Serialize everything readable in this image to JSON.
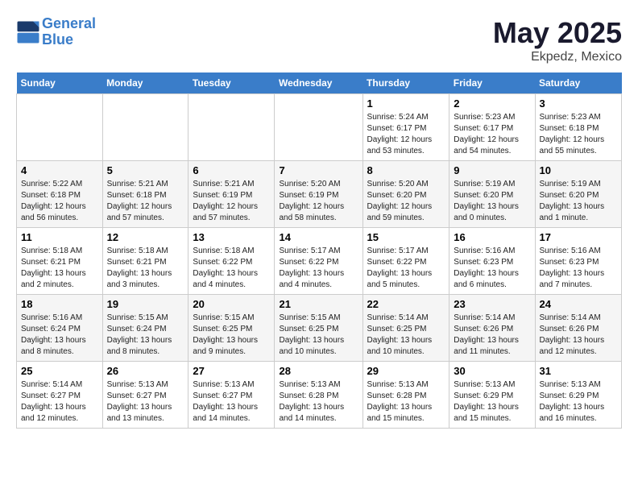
{
  "header": {
    "logo_line1": "General",
    "logo_line2": "Blue",
    "month_title": "May 2025",
    "location": "Ekpedz, Mexico"
  },
  "days_of_week": [
    "Sunday",
    "Monday",
    "Tuesday",
    "Wednesday",
    "Thursday",
    "Friday",
    "Saturday"
  ],
  "weeks": [
    [
      {
        "day": "",
        "info": ""
      },
      {
        "day": "",
        "info": ""
      },
      {
        "day": "",
        "info": ""
      },
      {
        "day": "",
        "info": ""
      },
      {
        "day": "1",
        "info": "Sunrise: 5:24 AM\nSunset: 6:17 PM\nDaylight: 12 hours\nand 53 minutes."
      },
      {
        "day": "2",
        "info": "Sunrise: 5:23 AM\nSunset: 6:17 PM\nDaylight: 12 hours\nand 54 minutes."
      },
      {
        "day": "3",
        "info": "Sunrise: 5:23 AM\nSunset: 6:18 PM\nDaylight: 12 hours\nand 55 minutes."
      }
    ],
    [
      {
        "day": "4",
        "info": "Sunrise: 5:22 AM\nSunset: 6:18 PM\nDaylight: 12 hours\nand 56 minutes."
      },
      {
        "day": "5",
        "info": "Sunrise: 5:21 AM\nSunset: 6:18 PM\nDaylight: 12 hours\nand 57 minutes."
      },
      {
        "day": "6",
        "info": "Sunrise: 5:21 AM\nSunset: 6:19 PM\nDaylight: 12 hours\nand 57 minutes."
      },
      {
        "day": "7",
        "info": "Sunrise: 5:20 AM\nSunset: 6:19 PM\nDaylight: 12 hours\nand 58 minutes."
      },
      {
        "day": "8",
        "info": "Sunrise: 5:20 AM\nSunset: 6:20 PM\nDaylight: 12 hours\nand 59 minutes."
      },
      {
        "day": "9",
        "info": "Sunrise: 5:19 AM\nSunset: 6:20 PM\nDaylight: 13 hours\nand 0 minutes."
      },
      {
        "day": "10",
        "info": "Sunrise: 5:19 AM\nSunset: 6:20 PM\nDaylight: 13 hours\nand 1 minute."
      }
    ],
    [
      {
        "day": "11",
        "info": "Sunrise: 5:18 AM\nSunset: 6:21 PM\nDaylight: 13 hours\nand 2 minutes."
      },
      {
        "day": "12",
        "info": "Sunrise: 5:18 AM\nSunset: 6:21 PM\nDaylight: 13 hours\nand 3 minutes."
      },
      {
        "day": "13",
        "info": "Sunrise: 5:18 AM\nSunset: 6:22 PM\nDaylight: 13 hours\nand 4 minutes."
      },
      {
        "day": "14",
        "info": "Sunrise: 5:17 AM\nSunset: 6:22 PM\nDaylight: 13 hours\nand 4 minutes."
      },
      {
        "day": "15",
        "info": "Sunrise: 5:17 AM\nSunset: 6:22 PM\nDaylight: 13 hours\nand 5 minutes."
      },
      {
        "day": "16",
        "info": "Sunrise: 5:16 AM\nSunset: 6:23 PM\nDaylight: 13 hours\nand 6 minutes."
      },
      {
        "day": "17",
        "info": "Sunrise: 5:16 AM\nSunset: 6:23 PM\nDaylight: 13 hours\nand 7 minutes."
      }
    ],
    [
      {
        "day": "18",
        "info": "Sunrise: 5:16 AM\nSunset: 6:24 PM\nDaylight: 13 hours\nand 8 minutes."
      },
      {
        "day": "19",
        "info": "Sunrise: 5:15 AM\nSunset: 6:24 PM\nDaylight: 13 hours\nand 8 minutes."
      },
      {
        "day": "20",
        "info": "Sunrise: 5:15 AM\nSunset: 6:25 PM\nDaylight: 13 hours\nand 9 minutes."
      },
      {
        "day": "21",
        "info": "Sunrise: 5:15 AM\nSunset: 6:25 PM\nDaylight: 13 hours\nand 10 minutes."
      },
      {
        "day": "22",
        "info": "Sunrise: 5:14 AM\nSunset: 6:25 PM\nDaylight: 13 hours\nand 10 minutes."
      },
      {
        "day": "23",
        "info": "Sunrise: 5:14 AM\nSunset: 6:26 PM\nDaylight: 13 hours\nand 11 minutes."
      },
      {
        "day": "24",
        "info": "Sunrise: 5:14 AM\nSunset: 6:26 PM\nDaylight: 13 hours\nand 12 minutes."
      }
    ],
    [
      {
        "day": "25",
        "info": "Sunrise: 5:14 AM\nSunset: 6:27 PM\nDaylight: 13 hours\nand 12 minutes."
      },
      {
        "day": "26",
        "info": "Sunrise: 5:13 AM\nSunset: 6:27 PM\nDaylight: 13 hours\nand 13 minutes."
      },
      {
        "day": "27",
        "info": "Sunrise: 5:13 AM\nSunset: 6:27 PM\nDaylight: 13 hours\nand 14 minutes."
      },
      {
        "day": "28",
        "info": "Sunrise: 5:13 AM\nSunset: 6:28 PM\nDaylight: 13 hours\nand 14 minutes."
      },
      {
        "day": "29",
        "info": "Sunrise: 5:13 AM\nSunset: 6:28 PM\nDaylight: 13 hours\nand 15 minutes."
      },
      {
        "day": "30",
        "info": "Sunrise: 5:13 AM\nSunset: 6:29 PM\nDaylight: 13 hours\nand 15 minutes."
      },
      {
        "day": "31",
        "info": "Sunrise: 5:13 AM\nSunset: 6:29 PM\nDaylight: 13 hours\nand 16 minutes."
      }
    ]
  ]
}
